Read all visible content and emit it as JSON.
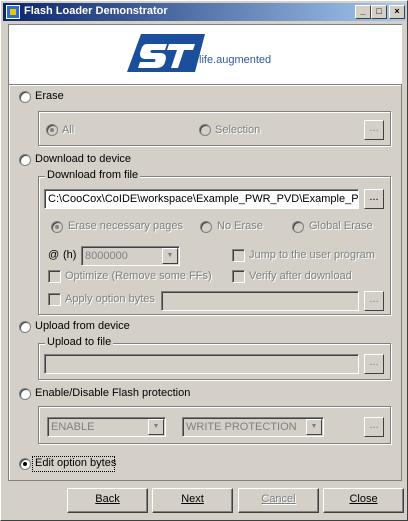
{
  "window": {
    "title": "Flash Loader Demonstrator",
    "controls": {
      "minimize": "_",
      "maximize": "□",
      "close": "×"
    }
  },
  "logo": {
    "tagline": "life.augmented",
    "brand_color": "#2c5aa0"
  },
  "erase": {
    "label": "Erase",
    "options": {
      "all": "All",
      "selection": "Selection"
    },
    "browse": "..."
  },
  "download": {
    "label": "Download to device",
    "group_title": "Download from file",
    "file_path": "C:\\CooCox\\CoIDE\\workspace\\Example_PWR_PVD\\Example_P",
    "browse": "...",
    "erase_options": {
      "necessary": "Erase necessary pages",
      "no_erase": "No Erase",
      "global": "Global Erase"
    },
    "address_at": "@",
    "address_unit": "(h)",
    "address_value": "8000000",
    "jump_label": "Jump to the user program",
    "optimize_label": "Optimize (Remove some FFs)",
    "verify_label": "Verify after download",
    "apply_option_label": "Apply option bytes",
    "apply_browse": "..."
  },
  "upload": {
    "label": "Upload from device",
    "group_title": "Upload to file",
    "browse": "..."
  },
  "protection": {
    "label": "Enable/Disable Flash protection",
    "enable_value": "ENABLE",
    "type_value": "WRITE PROTECTION",
    "browse": "..."
  },
  "option_bytes": {
    "label": "Edit option bytes"
  },
  "buttons": {
    "back": "Back",
    "next": "Next",
    "cancel": "Cancel",
    "close": "Close"
  }
}
